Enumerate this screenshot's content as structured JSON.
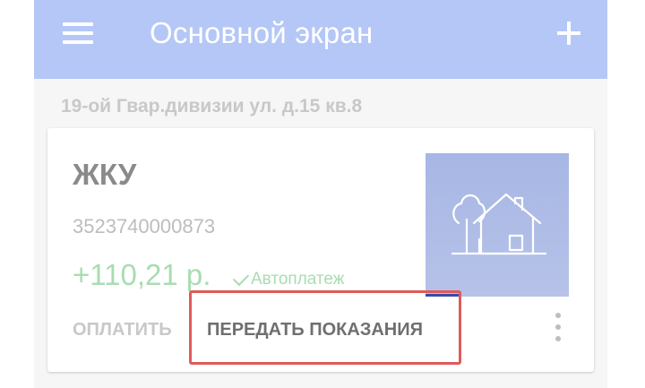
{
  "appbar": {
    "title": "Основной экран",
    "menu_icon": "hamburger-menu-icon",
    "add_icon": "plus-icon",
    "color": "#b4c7f7"
  },
  "address": "19-ой Гвар.дивизии ул. д.15 кв.8",
  "card": {
    "title": "ЖКУ",
    "account": "3523740000873",
    "amount": "+110,21 р.",
    "autopay_label": "Автоплатеж",
    "autopay_icon": "checkmark-icon",
    "pay_button": "ОПЛАТИТЬ",
    "readings_button": "ПЕРЕДАТЬ ПОКАЗАНИЯ",
    "more_icon": "more-vertical-icon",
    "tile_icon": "house-with-trees-icon",
    "amount_color": "#a9dcb1",
    "highlight_color": "#e05a5a"
  }
}
